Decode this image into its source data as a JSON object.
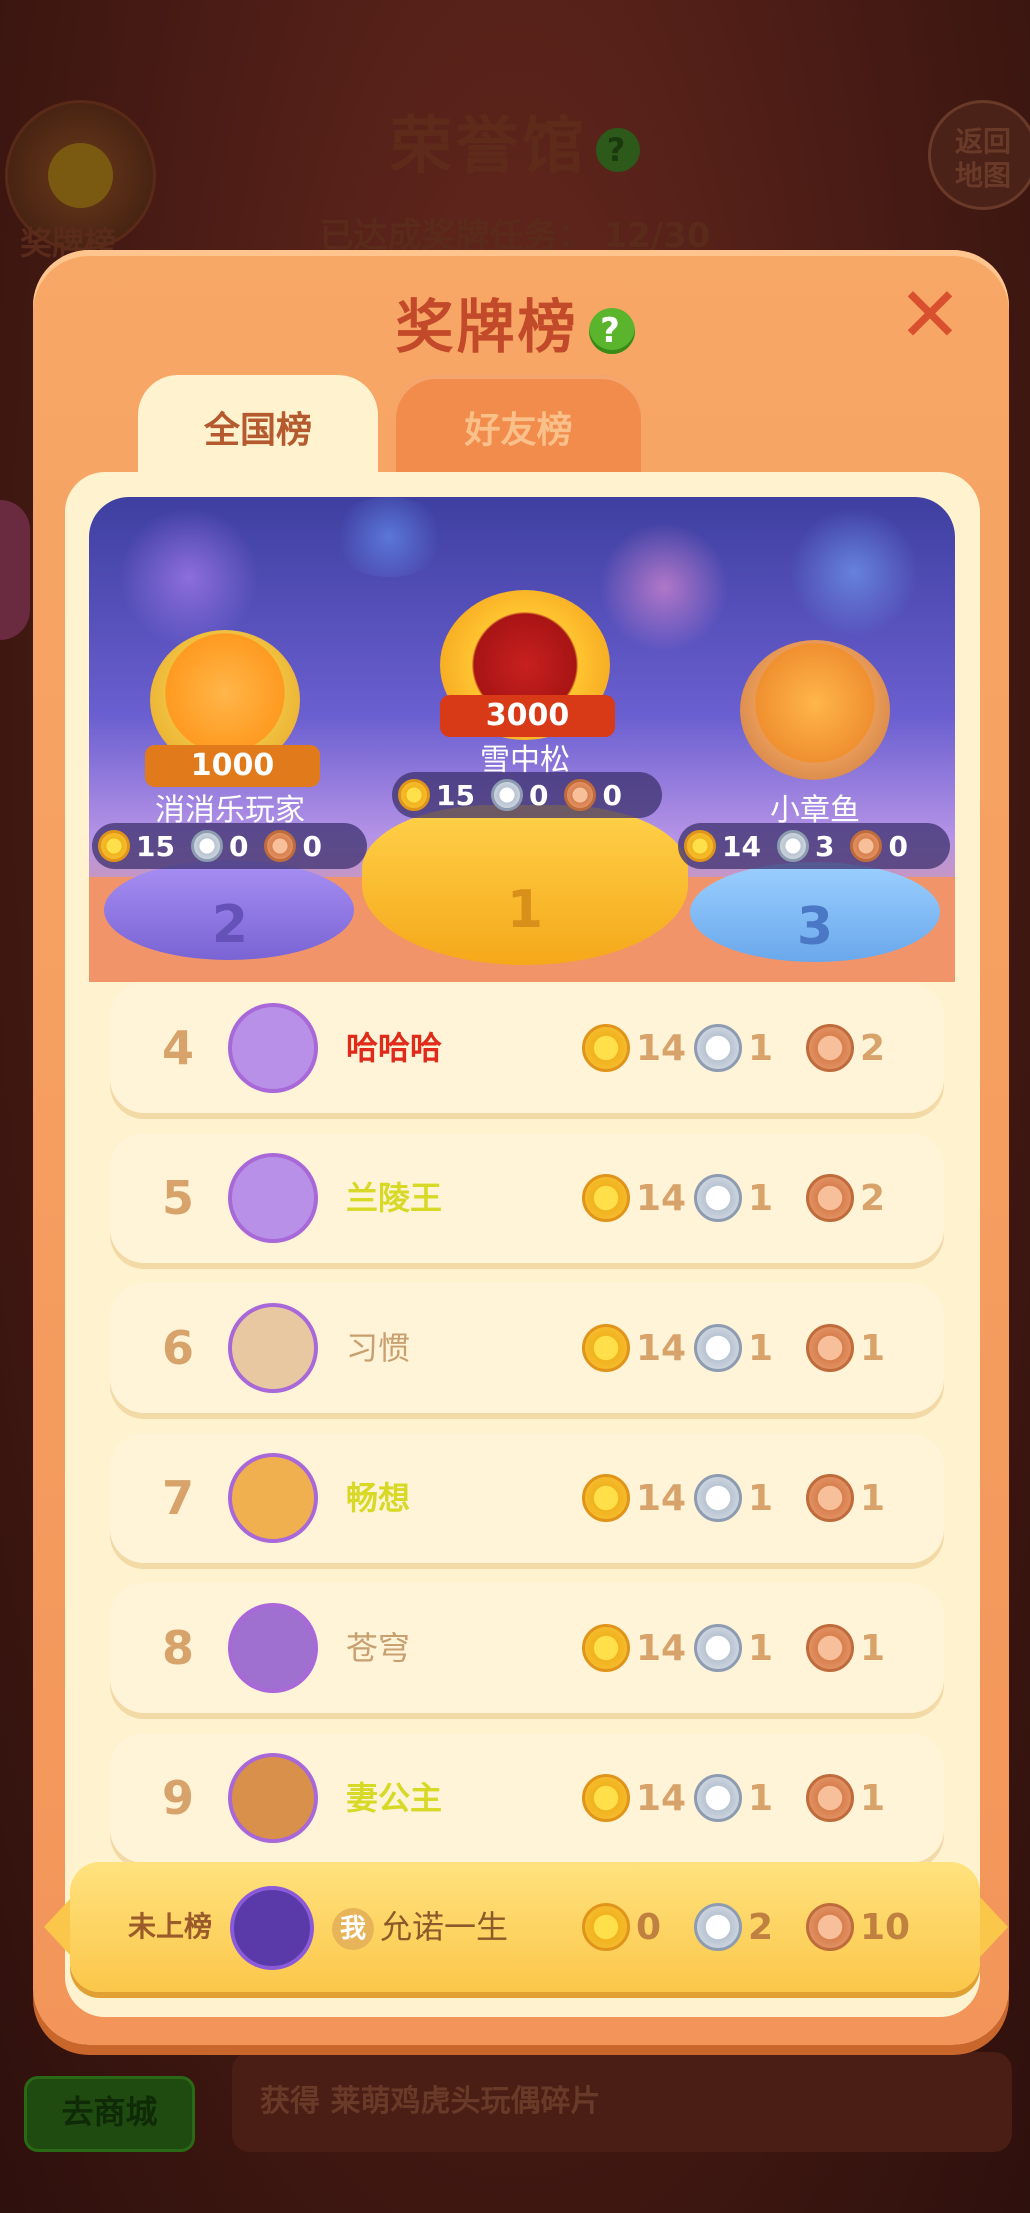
{
  "background": {
    "title": "荣誉馆",
    "progress_label": "已达成奖牌任务：",
    "progress_value": "12/30",
    "medal_button_label": "奖牌榜",
    "back_button_line1": "返回",
    "back_button_line2": "地图",
    "shop_button_label": "去商城",
    "reward_text": "获得 莱萌鸡虎头玩偶碎片"
  },
  "modal": {
    "title": "奖牌榜",
    "help_label": "?",
    "close_label": "✕",
    "tabs": [
      {
        "label": "全国榜",
        "active": true
      },
      {
        "label": "好友榜",
        "active": false
      }
    ]
  },
  "podium": [
    {
      "place": "2",
      "name": "消消乐玩家",
      "banner": "1000",
      "gold": "15",
      "silver": "0",
      "bronze": "0"
    },
    {
      "place": "1",
      "name": "雪中松",
      "banner": "3000",
      "gold": "15",
      "silver": "0",
      "bronze": "0"
    },
    {
      "place": "3",
      "name": "小章鱼",
      "banner": "",
      "gold": "14",
      "silver": "3",
      "bronze": "0"
    }
  ],
  "rows": [
    {
      "rank": "4",
      "name": "哈哈哈",
      "name_color": "#e02a1a",
      "gold": "14",
      "silver": "1",
      "bronze": "2"
    },
    {
      "rank": "5",
      "name": "兰陵王",
      "name_color": "#d8d826",
      "gold": "14",
      "silver": "1",
      "bronze": "2"
    },
    {
      "rank": "6",
      "name": "习惯",
      "name_color": "#c8a070",
      "gold": "14",
      "silver": "1",
      "bronze": "1"
    },
    {
      "rank": "7",
      "name": "畅想",
      "name_color": "#d8d826",
      "gold": "14",
      "silver": "1",
      "bronze": "1"
    },
    {
      "rank": "8",
      "name": "苍穹",
      "name_color": "#c8a070",
      "gold": "14",
      "silver": "1",
      "bronze": "1"
    },
    {
      "rank": "9",
      "name": "妻公主",
      "name_color": "#d8d826",
      "gold": "14",
      "silver": "1",
      "bronze": "1"
    }
  ],
  "self": {
    "rank_label": "未上榜",
    "me_badge": "我",
    "name": "允诺一生",
    "gold": "0",
    "silver": "2",
    "bronze": "10"
  }
}
